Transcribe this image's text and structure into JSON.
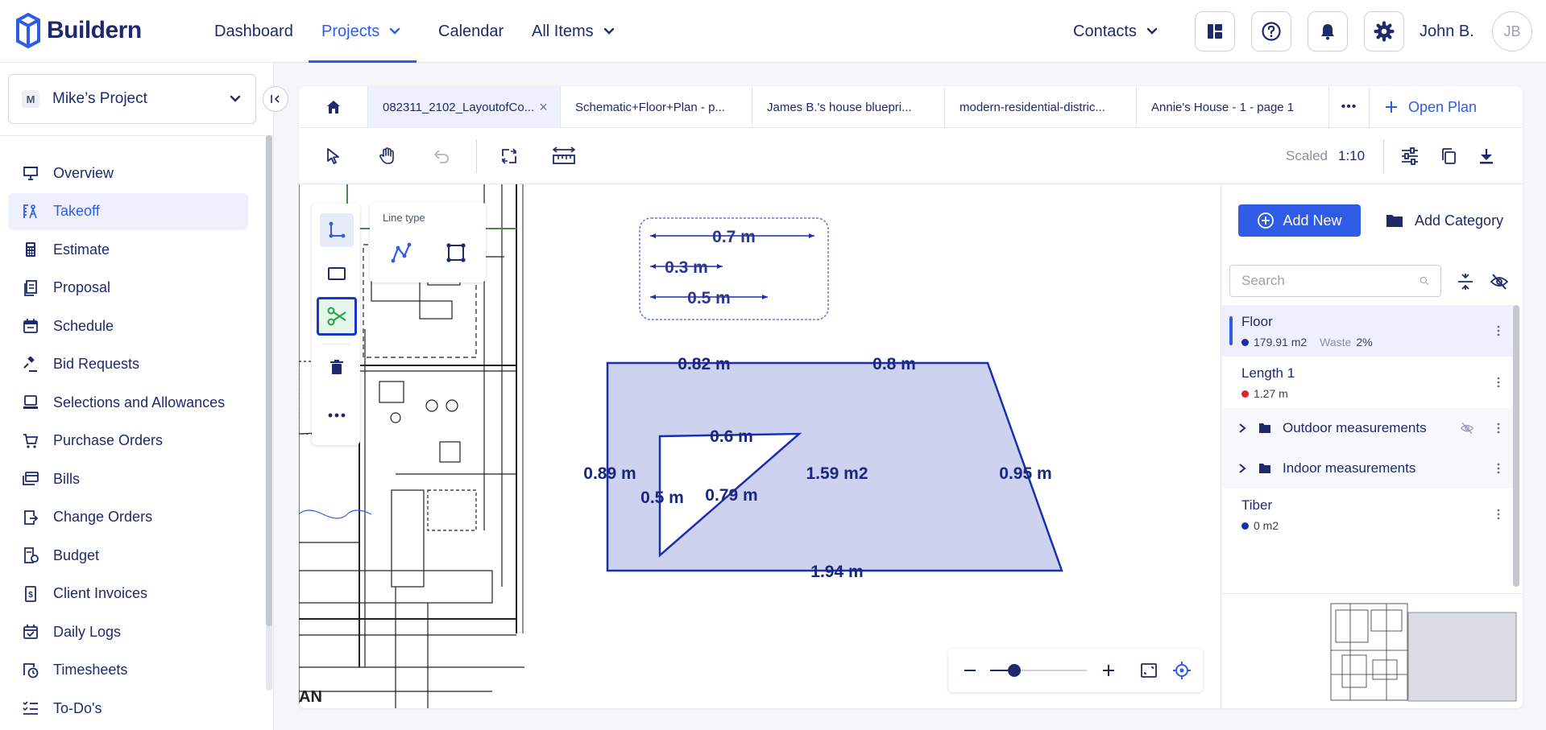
{
  "brand": {
    "name": "Buildern",
    "color": "#1e2a6b",
    "accent": "#2f5ce6"
  },
  "topnav": {
    "items": [
      {
        "label": "Dashboard",
        "active": false
      },
      {
        "label": "Projects",
        "active": true,
        "dropdown": true
      },
      {
        "label": "Calendar",
        "active": false
      },
      {
        "label": "All Items",
        "active": false,
        "dropdown": true
      }
    ],
    "contacts_label": "Contacts",
    "icons": [
      "layout-icon",
      "help-icon",
      "bell-icon",
      "gear-icon"
    ],
    "user_name": "John B.",
    "user_initials": "JB"
  },
  "sidebar": {
    "project_badge": "M",
    "project_name": "Mike’s Project",
    "items": [
      {
        "label": "Overview",
        "icon": "easel-icon"
      },
      {
        "label": "Takeoff",
        "icon": "takeoff-icon",
        "active": true
      },
      {
        "label": "Estimate",
        "icon": "calculator-icon"
      },
      {
        "label": "Proposal",
        "icon": "proposal-icon"
      },
      {
        "label": "Schedule",
        "icon": "calendar-icon"
      },
      {
        "label": "Bid Requests",
        "icon": "gavel-icon"
      },
      {
        "label": "Selections and Allowances",
        "icon": "laptop-icon"
      },
      {
        "label": "Purchase Orders",
        "icon": "cart-icon"
      },
      {
        "label": "Bills",
        "icon": "bill-icon"
      },
      {
        "label": "Change Orders",
        "icon": "change-order-icon"
      },
      {
        "label": "Budget",
        "icon": "budget-icon"
      },
      {
        "label": "Client Invoices",
        "icon": "invoice-icon"
      },
      {
        "label": "Daily Logs",
        "icon": "daily-log-icon"
      },
      {
        "label": "Timesheets",
        "icon": "timesheet-icon"
      },
      {
        "label": "To-Do's",
        "icon": "todo-icon"
      }
    ]
  },
  "tabs": {
    "items": [
      {
        "label": "082311_2102_LayoutofCo...",
        "active": true,
        "closable": true
      },
      {
        "label": "Schematic+Floor+Plan - p..."
      },
      {
        "label": "James B.'s house bluepri..."
      },
      {
        "label": "modern-residential-distric..."
      },
      {
        "label": "Annie's House - 1 - page 1"
      }
    ],
    "more": "•••",
    "open_plan": "Open Plan"
  },
  "toolbar": {
    "scale_label": "Scaled",
    "scale_value": "1:10"
  },
  "canvas": {
    "line_type_label": "Line type",
    "plan_label": "AN",
    "legend_measures": [
      "0.7 m",
      "0.3 m",
      "0.5 m"
    ],
    "shape_labels": {
      "top_left": "0.82 m",
      "top_right": "0.8 m",
      "left": "0.89 m",
      "right": "0.95 m",
      "bottom": "1.94 m",
      "area": "1.59 m2",
      "tri_top": "0.6 m",
      "tri_left": "0.5 m",
      "tri_hyp": "0.79 m"
    },
    "zoom_level": 0.25
  },
  "panel": {
    "add_new": "Add New",
    "add_category": "Add Category",
    "search_placeholder": "Search",
    "items": [
      {
        "title": "Floor",
        "value": "179.91 m2",
        "waste_label": "Waste",
        "waste": "2%",
        "color": "#1a2fb0",
        "active": true
      },
      {
        "title": "Length 1",
        "value": "1.27 m",
        "color": "#e02424"
      }
    ],
    "groups": [
      {
        "label": "Outdoor measurements",
        "hidden": true
      },
      {
        "label": "Indoor measurements"
      }
    ],
    "items_after": [
      {
        "title": "Tiber",
        "value": "0 m2",
        "color": "#1a2fb0"
      }
    ]
  }
}
